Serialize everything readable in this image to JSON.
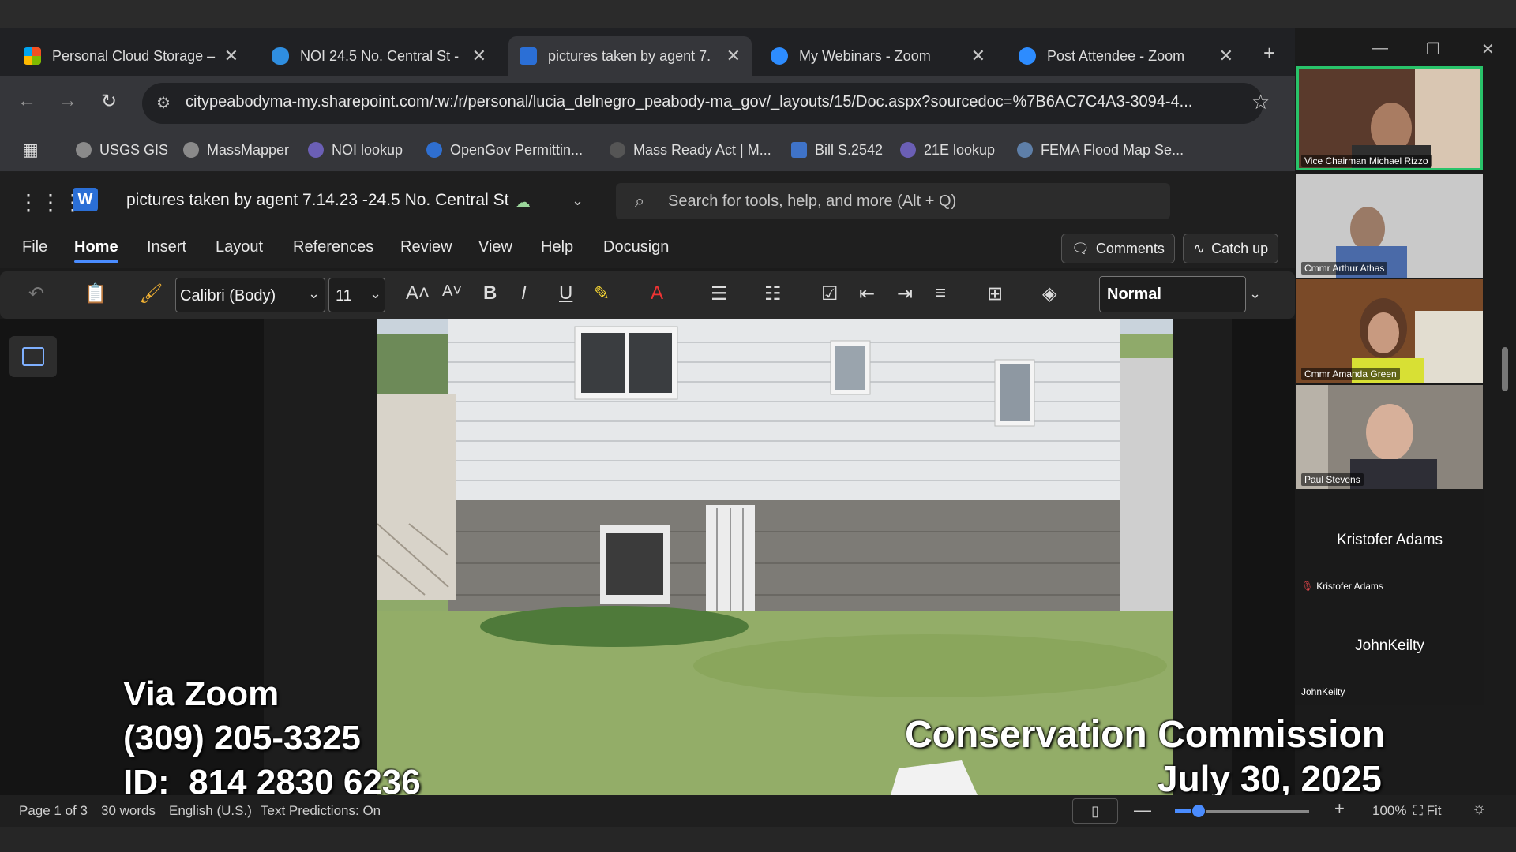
{
  "browser": {
    "tabs": [
      {
        "title": "Personal Cloud Storage – ",
        "icon": "microsoft-icon",
        "color": "#f25022"
      },
      {
        "title": "NOI 24.5 No. Central St - ",
        "icon": "onedrive-icon",
        "color": "#2f8ee0"
      },
      {
        "title": "pictures taken by agent 7.",
        "icon": "word-icon",
        "color": "#2b6fd6"
      },
      {
        "title": "My Webinars - Zoom",
        "icon": "zoom-icon",
        "color": "#2d8cff"
      },
      {
        "title": "Post Attendee - Zoom",
        "icon": "zoom-icon",
        "color": "#2d8cff"
      }
    ],
    "url": "citypeabodyma-my.sharepoint.com/:w:/r/personal/lucia_delnegro_peabody-ma_gov/_layouts/15/Doc.aspx?sourcedoc=%7B6AC7C4A3-3094-4...",
    "bookmarks": [
      "USGS GIS",
      "MassMapper",
      "NOI lookup",
      "OpenGov Permittin...",
      "Mass Ready Act | M...",
      "Bill S.2542",
      "21E lookup",
      "FEMA Flood Map Se..."
    ]
  },
  "word": {
    "doc_title": "pictures taken by agent 7.14.23 -24.5 No. Central St",
    "search_placeholder": "Search for tools, help, and more (Alt + Q)",
    "menu": [
      "File",
      "Home",
      "Insert",
      "Layout",
      "References",
      "Review",
      "View",
      "Help",
      "Docusign"
    ],
    "comments_label": "Comments",
    "catchup_label": "Catch up",
    "font": "Calibri (Body)",
    "font_size": "11",
    "style": "Normal"
  },
  "overlay": {
    "left_line1": "Via Zoom",
    "left_line2": "(309) 205-3325",
    "left_line3": "ID:  814 2830 6236",
    "right_line1": "Conservation Commission",
    "right_line2": "July 30, 2025"
  },
  "status": {
    "page": "Page 1 of 3",
    "words": "30 words",
    "language": "English (U.S.)",
    "predictions": "Text Predictions: On",
    "zoom_level": "100%",
    "fit": "Fit",
    "zoom_fraction": 0.5
  },
  "participants": [
    {
      "name": "Vice Chairman Michael Rizzo"
    },
    {
      "name": "Cmmr Arthur Athas"
    },
    {
      "name": "Cmmr Amanda Green"
    },
    {
      "name": "Paul Stevens"
    }
  ],
  "name_tiles": [
    {
      "display": "Kristofer Adams",
      "label": "Kristofer Adams"
    },
    {
      "display": "JohnKeilty",
      "label": "JohnKeilty"
    }
  ],
  "colors": {
    "accent": "#4a8cff",
    "speaking": "#29c36a"
  }
}
